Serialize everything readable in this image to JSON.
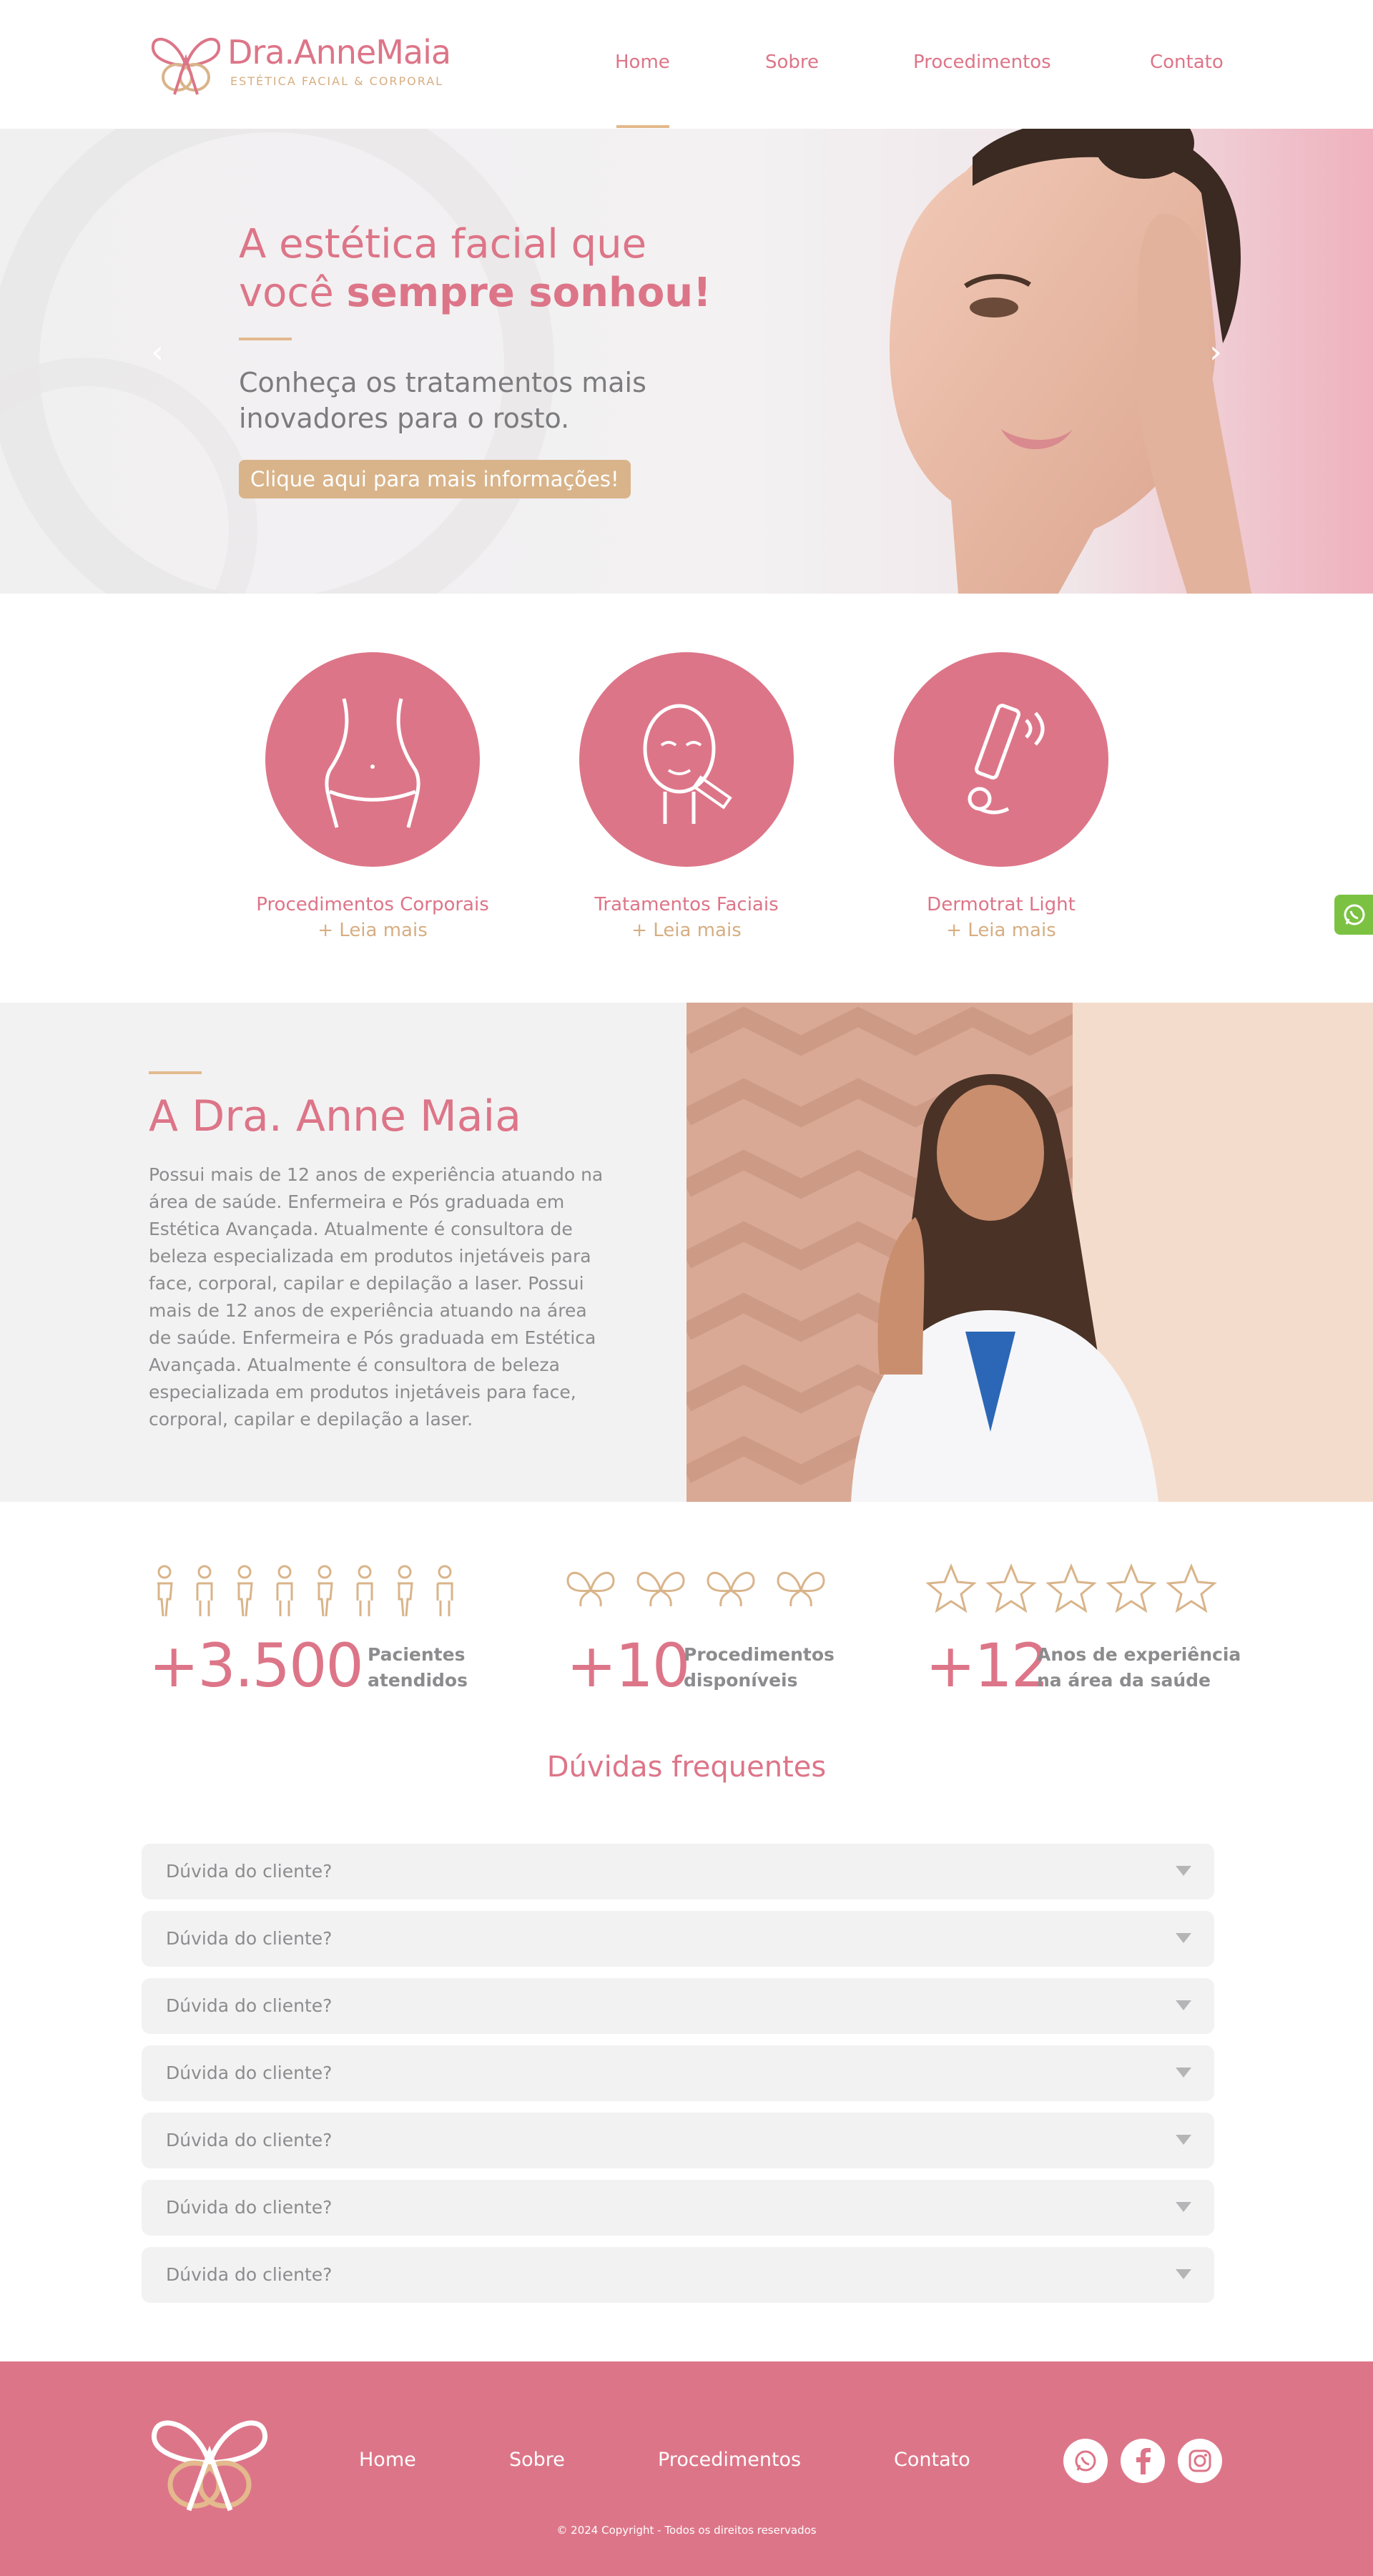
{
  "header": {
    "logo_name": "Dra.AnneMaia",
    "logo_sub": "ESTÉTICA FACIAL & CORPORAL",
    "nav": [
      "Home",
      "Sobre",
      "Procedimentos",
      "Contato"
    ],
    "active_nav": "Home"
  },
  "hero": {
    "title_line1": "A estética facial que",
    "title_line2_regular": "você ",
    "title_line2_bold": "sempre sonhou!",
    "subtitle": "Conheça os tratamentos mais inovadores para o rosto.",
    "cta_label": "Clique aqui para mais informações!",
    "prev_icon": "chevron-left-icon",
    "next_icon": "chevron-right-icon"
  },
  "services": [
    {
      "title": "Procedimentos  Corporais",
      "more": "+ Leia mais",
      "icon": "body-waist-icon"
    },
    {
      "title": "Tratamentos Faciais",
      "more": "+ Leia mais",
      "icon": "face-injection-icon"
    },
    {
      "title": "Dermotrat Light",
      "more": "+ Leia mais",
      "icon": "laser-device-icon"
    }
  ],
  "about": {
    "title": "A Dra. Anne Maia",
    "text": "Possui mais de 12 anos de experiência atuando na área de saúde. Enfermeira e Pós graduada em Estética Avançada. Atualmente é consultora de beleza especializada em produtos injetáveis para face, corporal, capilar e depilação a laser. Possui mais de 12 anos de experiência atuando na área de saúde. Enfermeira e Pós graduada em Estética Avançada. Atualmente é consultora de beleza especializada em produtos injetáveis para face, corporal, capilar e depilação a laser."
  },
  "stats": [
    {
      "number": "+3.500",
      "label_line1": "Pacientes",
      "label_line2": "atendidos",
      "icon": "person-icon"
    },
    {
      "number": "+10",
      "label_line1": "Procedimentos",
      "label_line2": "disponíveis",
      "icon": "butterfly-icon"
    },
    {
      "number": "+12",
      "label_line1": "Anos de experiência",
      "label_line2": "na área da saúde",
      "icon": "star-icon"
    }
  ],
  "faq": {
    "title": "Dúvidas frequentes",
    "items": [
      "Dúvida do cliente?",
      "Dúvida do cliente?",
      "Dúvida do cliente?",
      "Dúvida do cliente?",
      "Dúvida do cliente?",
      "Dúvida do cliente?",
      "Dúvida do cliente?"
    ]
  },
  "footer": {
    "nav": [
      "Home",
      "Sobre",
      "Procedimentos",
      "Contato"
    ],
    "social": [
      "whatsapp-icon",
      "facebook-icon",
      "instagram-icon"
    ],
    "copyright": "© 2024 Copyright - Todos os direitos reservados"
  },
  "colors": {
    "pink": "#dd7588",
    "gold": "#d9b48a",
    "gray_text": "#8c8b8d",
    "light_bg": "#f3f2f3",
    "whatsapp_green": "#7cc242"
  }
}
